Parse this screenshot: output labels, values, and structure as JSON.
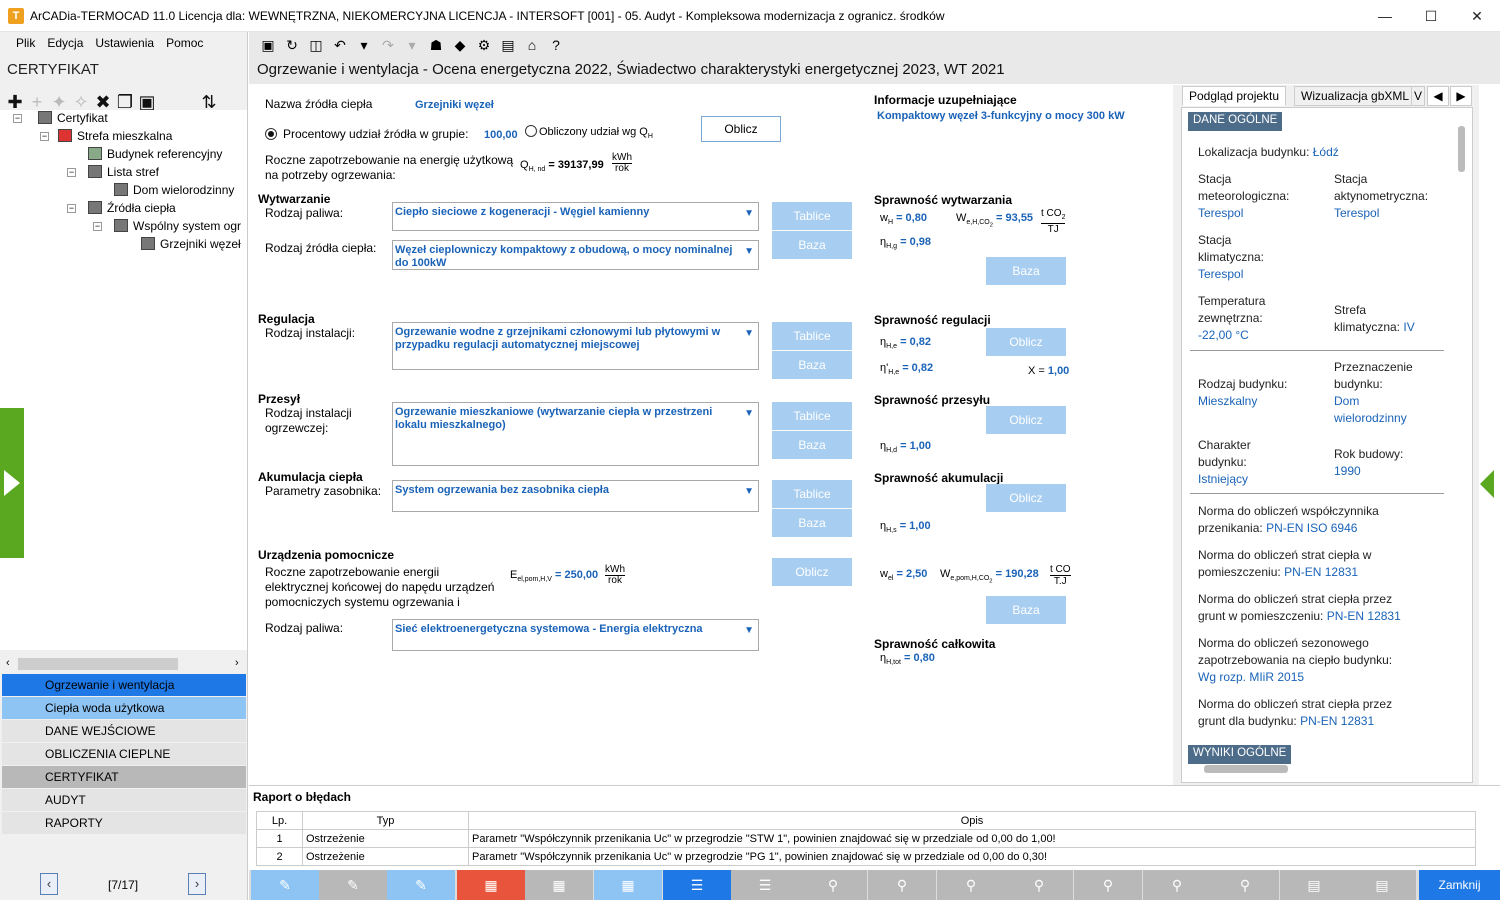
{
  "window": {
    "title": "ArCADia-TERMOCAD 11.0 Licencja dla: WEWNĘTRZNA, NIEKOMERCYJNA LICENCJA - INTERSOFT [001] - 05. Audyt - Kompleksowa modernizacja z ogranicz. środków",
    "app_icon": "T"
  },
  "menu": {
    "items": [
      "Plik",
      "Edycja",
      "Ustawienia",
      "Pomoc"
    ]
  },
  "left": {
    "heading": "CERTYFIKAT",
    "tree": [
      "Certyfikat",
      "Strefa mieszkalna",
      "Budynek referencyjny",
      "Lista stref",
      "Dom wielorodzinny",
      "Źródła ciepła",
      "Wspólny system ogr",
      "Grzejniki węzeł"
    ],
    "nav": [
      "Ogrzewanie i wentylacja",
      "Ciepła woda użytkowa",
      "DANE WEJŚCIOWE",
      "OBLICZENIA CIEPLNE",
      "CERTYFIKAT",
      "AUDYT",
      "RAPORTY"
    ],
    "pager": {
      "label": "[7/17]",
      "prev": "‹",
      "next": "›"
    }
  },
  "main": {
    "title": "Ogrzewanie i wentylacja - Ocena energetyczna 2022, Świadectwo charakterystyki energetycznej 2023, WT 2021",
    "source_name_label": "Nazwa źródła ciepła",
    "source_name_value": "Grzejniki węzeł",
    "radio1_label": "Procentowy udział źródła w grupie:",
    "radio1_value": "100,00",
    "radio2_label": "Obliczony udział wg Q",
    "radio2_sub": "H",
    "oblicz": "Oblicz",
    "annual_label1": "Roczne zapotrzebowanie na energię użytkową",
    "annual_label2": "na potrzeby ogrzewania:",
    "qhnd_sym": "Q",
    "qhnd_sub": "H, nd",
    "qhnd_value": "= 39137,99",
    "unit_kwh": "kWh",
    "unit_rok": "rok",
    "info_label": "Informacje uzupełniające",
    "info_value": "Kompaktowy węzeł 3-funkcyjny o mocy 300 kW",
    "sections": {
      "wytwarzanie": {
        "title": "Wytwarzanie",
        "label1": "Rodzaj paliwa:",
        "value1": "Ciepło sieciowe z kogeneracji - Węgiel kamienny",
        "label2": "Rodzaj źródła ciepła:",
        "value2": "Węzeł cieplowniczy kompaktowy z obudową, o mocy nominalnej do 100kW"
      },
      "regulacja": {
        "title": "Regulacja",
        "label": "Rodzaj instalacji:",
        "value": "Ogrzewanie wodne z grzejnikami członowymi lub płytowymi w przypadku regulacji automatycznej miejscowej"
      },
      "przesyl": {
        "title": "Przesył",
        "label1": "Rodzaj instalacji",
        "label2": "ogrzewczej:",
        "value": "Ogrzewanie mieszkaniowe (wytwarzanie ciepła w przestrzeni lokalu mieszkalnego)"
      },
      "akumulacja": {
        "title": "Akumulacja ciepła",
        "label": "Parametry zasobnika:",
        "value": "System ogrzewania bez zasobnika ciepła"
      },
      "pomocnicze": {
        "title": "Urządzenia pomocnicze",
        "label1": "Roczne zapotrzebowanie energii",
        "label2": "elektrycznej końcowej do napędu urządzeń",
        "label3": "pomocniczych systemu ogrzewania i",
        "e_sym": "E",
        "e_sub": "el,pom,H,V",
        "e_value": "= 250,00",
        "fuel_label": "Rodzaj paliwa:",
        "fuel_value": "Sieć elektroenergetyczna systemowa - Energia elektryczna"
      }
    },
    "buttons": {
      "tablice": "Tablice",
      "baza": "Baza",
      "oblicz": "Oblicz"
    },
    "eff": {
      "wyt_title": "Sprawność wytwarzania",
      "wh": "w",
      "wh_sub": "H",
      "wh_val": "= 0,80",
      "we": "W",
      "we_sub": "e,H,CO",
      "we_sub2": "2",
      "we_val": "= 93,55",
      "we_unit1": "t CO",
      "we_unit1_sub": "2",
      "we_unit2": "TJ",
      "nhg": "η",
      "nhg_sub": "H,g",
      "nhg_val": "= 0,98",
      "reg_title": "Sprawność regulacji",
      "nhe": "η",
      "nhe_sub": "H,e",
      "nhe_val": "= 0,82",
      "nhe2": "η'",
      "nhe2_sub": "H,e",
      "nhe2_val": "= 0,82",
      "x_label": "X =",
      "x_val": "1,00",
      "prz_title": "Sprawność przesyłu",
      "nhd": "η",
      "nhd_sub": "H,d",
      "nhd_val": "= 1,00",
      "aku_title": "Sprawność akumulacji",
      "nhs": "η",
      "nhs_sub": "H,s",
      "nhs_val": "= 1,00",
      "wel": "w",
      "wel_sub": "el",
      "wel_val": "= 2,50",
      "wel2": "W",
      "wel2_sub": "e,pom,H,CO",
      "wel2_sub2": "2",
      "wel2_val": "= 190,28",
      "wel2_unit1": "t CO",
      "wel2_unit2": "T.J",
      "tot_title": "Sprawność całkowita",
      "ntot": "η",
      "ntot_sub": "H,tot",
      "ntot_val": "= 0,80"
    }
  },
  "right": {
    "tabs": [
      "Podgląd projektu",
      "Wizualizacja gbXML",
      "V"
    ],
    "section1": "DANE OGÓLNE",
    "section2": "WYNIKI OGÓLNE",
    "lok_label": "Lokalizacja budynku:",
    "lok_val": "Łódź",
    "met_label1": "Stacja",
    "met_label2": "meteorologiczna:",
    "met_val": "Terespol",
    "akt_label1": "Stacja",
    "akt_label2": "aktynometryczna:",
    "akt_val": "Terespol",
    "klim_label1": "Stacja",
    "klim_label2": "klimatyczna:",
    "klim_val": "Terespol",
    "temp_label1": "Temperatura",
    "temp_label2": "zewnętrzna:",
    "temp_val": "-22,00 °C",
    "strefa_label1": "Strefa",
    "strefa_label2": "klimatyczna:",
    "strefa_val": "IV",
    "rodz_label": "Rodzaj budynku:",
    "rodz_val": "Mieszkalny",
    "przezn_label1": "Przeznaczenie",
    "przezn_label2": "budynku:",
    "przezn_val1": "Dom",
    "przezn_val2": "wielorodzinny",
    "char_label1": "Charakter",
    "char_label2": "budynku:",
    "char_val": "Istniejący",
    "rok_label": "Rok budowy:",
    "rok_val": "1990",
    "n1_label1": "Norma do obliczeń współczynnika",
    "n1_label2": "przenikania:",
    "n1_val": "PN-EN ISO 6946",
    "n2_label1": "Norma do obliczeń strat ciepła w",
    "n2_label2": "pomieszczeniu:",
    "n2_val": "PN-EN 12831",
    "n3_label1": "Norma do obliczeń strat ciepła przez",
    "n3_label2": "grunt w pomieszczeniu:",
    "n3_val": "PN-EN 12831",
    "n4_label1": "Norma do obliczeń sezonowego",
    "n4_label2": "zapotrzebowania na ciepło budynku:",
    "n4_val": "Wg rozp. MIiR 2015",
    "n5_label1": "Norma do obliczeń strat ciepła przez",
    "n5_label2": "grunt dla budynku:",
    "n5_val": "PN-EN 12831"
  },
  "errors": {
    "title": "Raport o błędach",
    "headers": [
      "Lp.",
      "Typ",
      "Opis"
    ],
    "rows": [
      {
        "lp": "1",
        "typ": "Ostrzeżenie",
        "opis": "Parametr \"Współczynnik przenikania Uc\" w przegrodzie \"STW 1\", powinien znajdować się w przedziale od 0,00 do 1,00!"
      },
      {
        "lp": "2",
        "typ": "Ostrzeżenie",
        "opis": "Parametr \"Współczynnik przenikania Uc\" w przegrodzie \"PG 1\", powinien znajdować się w przedziale od 0,00 do 0,30!"
      }
    ]
  },
  "footer": {
    "close": "Zamknij"
  },
  "colors": {
    "nav_active": "#1e78e6",
    "nav_second": "#8ec4f4",
    "red_tab": "#e8553c",
    "accent": "#1a63b8",
    "green": "#5aa820"
  }
}
